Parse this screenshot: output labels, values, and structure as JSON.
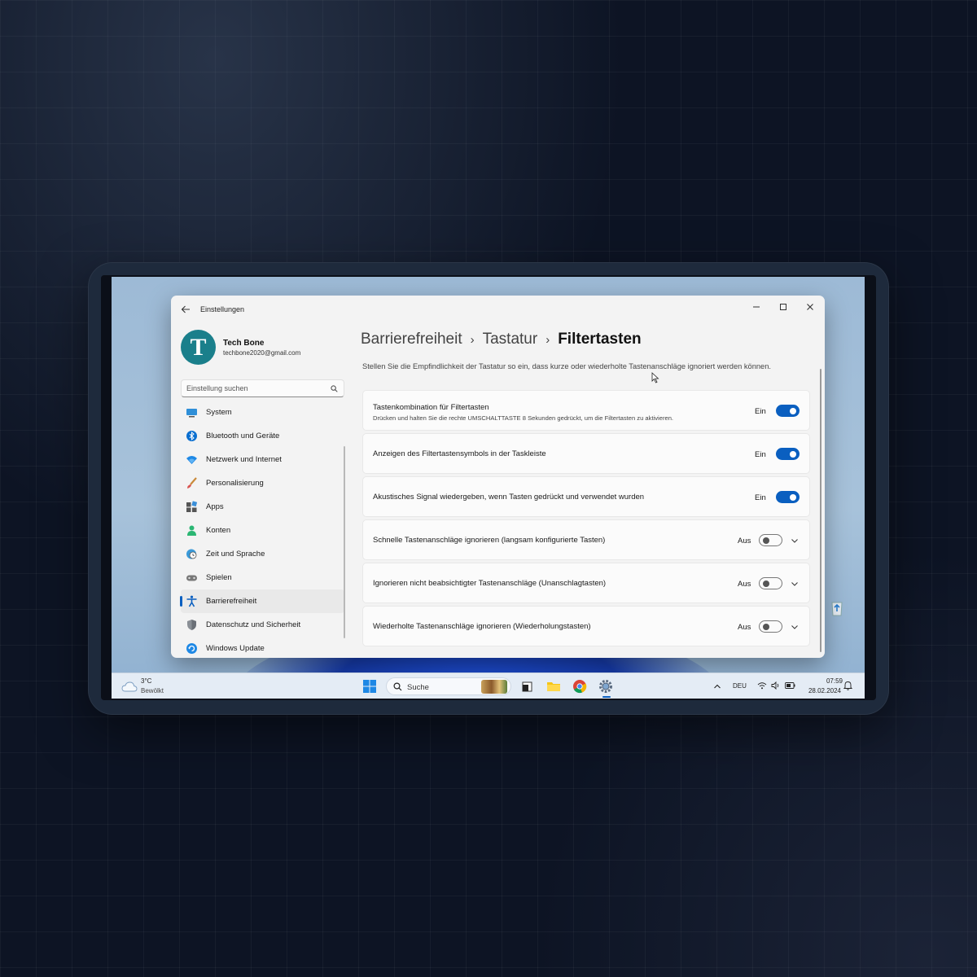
{
  "app": {
    "title": "Einstellungen"
  },
  "user": {
    "name": "Tech Bone",
    "email": "techbone2020@gmail.com",
    "initial": "T"
  },
  "search": {
    "placeholder": "Einstellung suchen"
  },
  "nav": {
    "items": [
      {
        "label": "System",
        "icon": "monitor-icon"
      },
      {
        "label": "Bluetooth und Geräte",
        "icon": "bluetooth-icon"
      },
      {
        "label": "Netzwerk und Internet",
        "icon": "wifi-icon"
      },
      {
        "label": "Personalisierung",
        "icon": "brush-icon"
      },
      {
        "label": "Apps",
        "icon": "apps-icon"
      },
      {
        "label": "Konten",
        "icon": "person-icon"
      },
      {
        "label": "Zeit und Sprache",
        "icon": "globe-clock-icon"
      },
      {
        "label": "Spielen",
        "icon": "gamepad-icon"
      },
      {
        "label": "Barrierefreiheit",
        "icon": "accessibility-icon",
        "active": true
      },
      {
        "label": "Datenschutz und Sicherheit",
        "icon": "shield-icon"
      },
      {
        "label": "Windows Update",
        "icon": "update-icon"
      }
    ]
  },
  "breadcrumb": {
    "level1": "Barrierefreiheit",
    "level2": "Tastatur",
    "current": "Filtertasten"
  },
  "description": "Stellen Sie die Empfindlichkeit der Tastatur so ein, dass kurze oder wiederholte Tastenanschläge ignoriert werden können.",
  "settings": [
    {
      "title": "Tastenkombination für Filtertasten",
      "subtitle": "Drücken und halten Sie die rechte UMSCHALTTASTE 8 Sekunden gedrückt, um die Filtertasten zu aktivieren.",
      "state": "Ein",
      "on": true,
      "expandable": false
    },
    {
      "title": "Anzeigen des Filtertastensymbols in der Taskleiste",
      "state": "Ein",
      "on": true,
      "expandable": false
    },
    {
      "title": "Akustisches Signal wiedergeben, wenn Tasten gedrückt und verwendet wurden",
      "state": "Ein",
      "on": true,
      "expandable": false
    },
    {
      "title": "Schnelle Tastenanschläge ignorieren (langsam konfigurierte Tasten)",
      "state": "Aus",
      "on": false,
      "expandable": true
    },
    {
      "title": "Ignorieren nicht beabsichtigter Tastenanschläge (Unanschlagtasten)",
      "state": "Aus",
      "on": false,
      "expandable": true
    },
    {
      "title": "Wiederholte Tastenanschläge ignorieren (Wiederholungstasten)",
      "state": "Aus",
      "on": false,
      "expandable": true
    }
  ],
  "taskbar": {
    "weather": {
      "temp": "3°C",
      "condition": "Bewölkt"
    },
    "search_label": "Suche",
    "language": "DEU",
    "time": "07:59",
    "date": "28.02.2024"
  },
  "colors": {
    "accent": "#0a5fc0",
    "avatar": "#1a7f8b"
  }
}
